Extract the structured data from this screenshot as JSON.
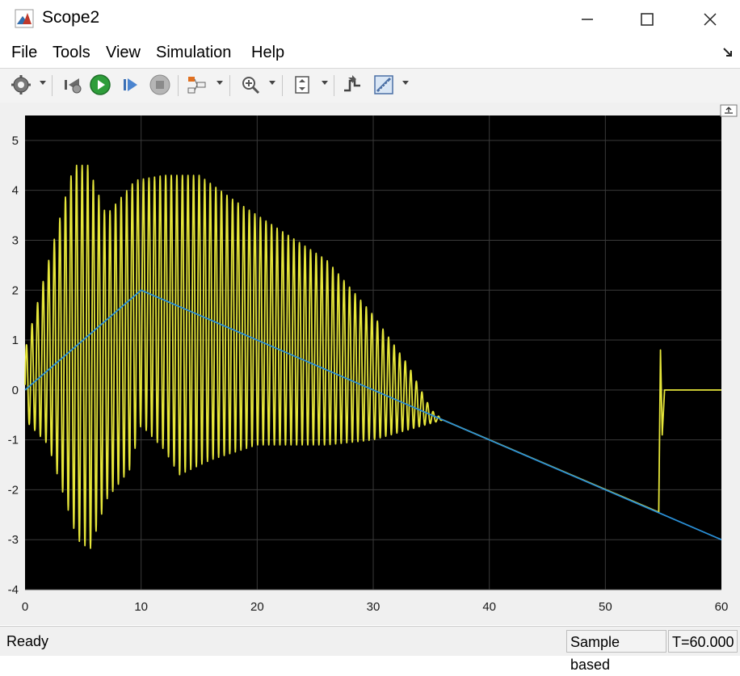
{
  "window": {
    "title": "Scope2",
    "controls": [
      "minimize",
      "maximize",
      "close"
    ]
  },
  "menu": {
    "items": [
      "File",
      "Tools",
      "View",
      "Simulation",
      "Help"
    ]
  },
  "toolbar": {
    "icons": [
      "gear-icon",
      "step-back-icon",
      "run-icon",
      "step-forward-icon",
      "stop-icon",
      "signal-select-icon",
      "zoom-icon",
      "scale-axes-icon",
      "triggers-icon",
      "measure-icon"
    ]
  },
  "status": {
    "ready": "Ready",
    "mode": "Sample based",
    "time": "T=60.000"
  },
  "colors": {
    "plot_background": "#000000",
    "grid": "#3a3a3a",
    "series_yellow": "#e6e63a",
    "series_blue": "#2a8fd6",
    "axis_text": "#1a1a1a"
  },
  "chart_data": {
    "type": "line",
    "xlim": [
      0,
      60
    ],
    "ylim": [
      -4,
      5.5
    ],
    "x_ticks": [
      "0",
      "10",
      "20",
      "30",
      "40",
      "50",
      "60"
    ],
    "y_ticks": [
      "5",
      "4",
      "3",
      "2",
      "1",
      "0",
      "-1",
      "-2",
      "-3",
      "-4"
    ],
    "grid": true,
    "series": [
      {
        "color": "#2a8fd6",
        "points": [
          [
            0,
            0
          ],
          [
            10,
            2
          ],
          [
            60,
            -3
          ]
        ]
      },
      {
        "color": "#e6e63a",
        "oscillation_center": [
          [
            0,
            0
          ],
          [
            10,
            2
          ],
          [
            36,
            -0.6
          ]
        ],
        "envelope_top": [
          [
            0,
            0.8
          ],
          [
            4.2,
            4.5
          ],
          [
            5.4,
            4.5
          ],
          [
            7,
            3.5
          ],
          [
            9.5,
            4.2
          ],
          [
            12,
            4.3
          ],
          [
            15,
            4.3
          ],
          [
            18,
            3.8
          ],
          [
            22,
            3.2
          ],
          [
            26,
            2.6
          ],
          [
            30,
            1.5
          ],
          [
            33,
            0.5
          ],
          [
            35,
            -0.4
          ],
          [
            36,
            -0.6
          ]
        ],
        "envelope_bottom": [
          [
            0,
            -0.6
          ],
          [
            2,
            -1.1
          ],
          [
            4.5,
            -3.0
          ],
          [
            5.6,
            -3.2
          ],
          [
            7,
            -2.2
          ],
          [
            9,
            -1.6
          ],
          [
            10,
            -0.7
          ],
          [
            12,
            -1.2
          ],
          [
            13.3,
            -1.7
          ],
          [
            16,
            -1.4
          ],
          [
            20,
            -1.1
          ],
          [
            26,
            -1.1
          ],
          [
            30,
            -1.0
          ],
          [
            33,
            -0.8
          ],
          [
            36,
            -0.6
          ]
        ],
        "oscillation_period": 0.48,
        "tail": [
          [
            36,
            -0.6
          ],
          [
            54.6,
            -2.45
          ],
          [
            54.75,
            0.8
          ],
          [
            54.9,
            -0.9
          ],
          [
            55.1,
            0.0
          ],
          [
            60,
            0.0
          ]
        ]
      }
    ]
  }
}
